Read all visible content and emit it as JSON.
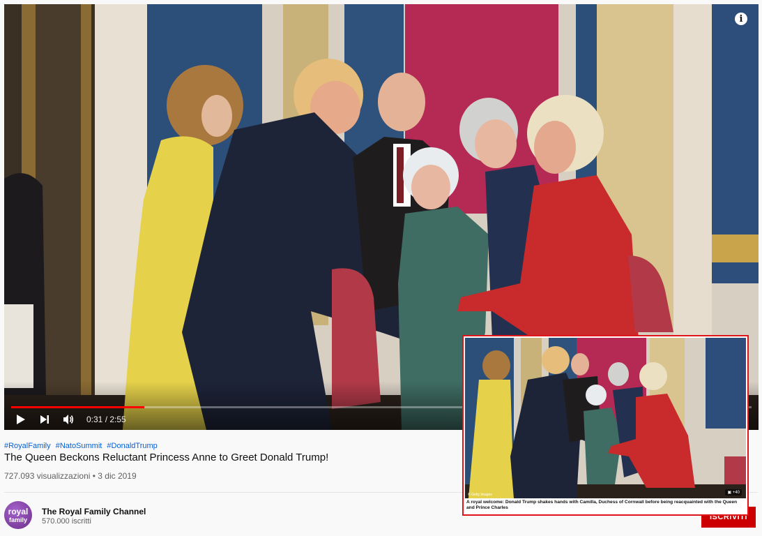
{
  "player": {
    "info_icon": "i",
    "progress_fraction": 0.18,
    "time": "0:31 / 2:55",
    "icons": [
      "play-icon",
      "next-icon",
      "volume-icon",
      "info-icon"
    ]
  },
  "video": {
    "hashtags": [
      "#RoyalFamily",
      "#NatoSummit",
      "#DonaldTrump"
    ],
    "title": "The Queen Beckons Reluctant Princess Anne to Greet Donald Trump!",
    "meta": "727.093 visualizzazioni • 3 dic 2019"
  },
  "channel": {
    "avatar_line1": "royal",
    "avatar_line2": "family",
    "name": "The Royal Family Channel",
    "subscribers": "570.000 iscritti"
  },
  "subscribe_label": "ISCRIVITI",
  "inset": {
    "caption": "A royal welcome: Donald Trump shakes hands with Camilla, Duchess of Cornwall before being reacquainted with the Queen and Prince Charles",
    "credit": "© Getty Images",
    "gallery_count": "+40"
  },
  "colors": {
    "accent_red": "#ff0000",
    "subscribe_red": "#cc0000",
    "link_blue": "#065fd4",
    "inset_border": "#e0151b"
  }
}
